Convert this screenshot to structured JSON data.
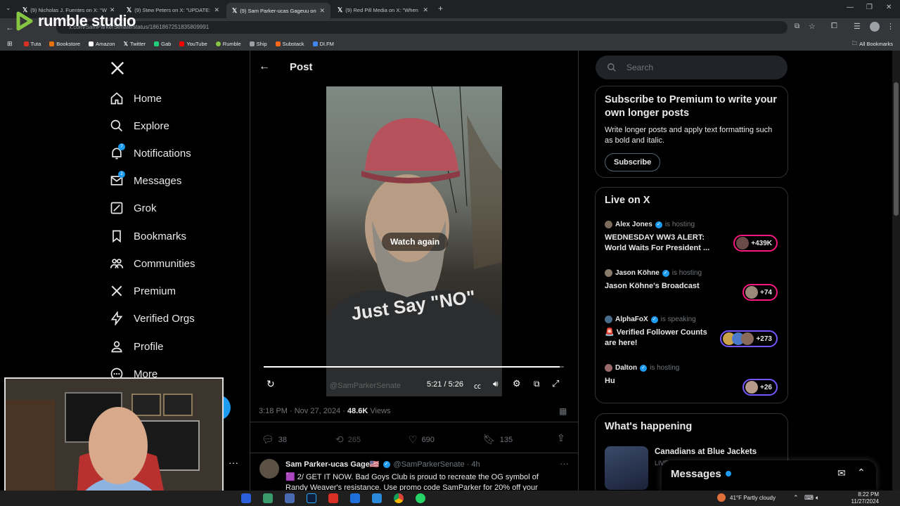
{
  "browser": {
    "tabs": [
      {
        "title": "(9) Nicholas J. Fuentes on X: \"W"
      },
      {
        "title": "(9) Stew Peters on X: \"UPDATE:"
      },
      {
        "title": "(9) Sam Parker-ucas Gageuu on"
      },
      {
        "title": "(9) Red Pill Media on X: \"When"
      }
    ],
    "url": "x.com/SamParkerSenate/status/1861867251835809991",
    "bookmarks": [
      "Tuta",
      "Bookstore",
      "Amazon",
      "Twitter",
      "Gab",
      "YouTube",
      "Rumble",
      "Ship",
      "Substack",
      "DI.FM"
    ],
    "all_bookmarks": "All Bookmarks"
  },
  "watermark": "rumble studio",
  "nav": {
    "items": [
      "Home",
      "Explore",
      "Notifications",
      "Messages",
      "Grok",
      "Bookmarks",
      "Communities",
      "Premium",
      "Verified Orgs",
      "Profile",
      "More"
    ],
    "notifications_badge": "7",
    "messages_badge": "2"
  },
  "header": {
    "title": "Post"
  },
  "video": {
    "overlay_label": "Watch again",
    "time": "5:21 / 5:26",
    "handle_watermark": "@SamParkerSenate",
    "shirt_text": "Just Say \"NO\"",
    "progress": 0.985
  },
  "post_meta": {
    "time": "3:18 PM · Nov 27, 2024 · ",
    "views_count": "48.6K",
    "views_label": " Views"
  },
  "actions": {
    "replies": "38",
    "reposts": "265",
    "likes": "690",
    "bookmarks": "135"
  },
  "reply": {
    "name": "Sam Parker-ucas Gage🇺🇸",
    "handle": "@SamParkerSenate · 4h",
    "text": "🟪 2/ GET IT NOW. Bad Goys Club is proud to recreate the OG symbol of Randy Weaver's resistance. Use promo code SamParker for 20% off your"
  },
  "search": {
    "placeholder": "Search"
  },
  "premium": {
    "title": "Subscribe to Premium to write your own longer posts",
    "body": "Write longer posts and apply text formatting such as bold and italic.",
    "button": "Subscribe"
  },
  "live": {
    "title": "Live on X",
    "rows": [
      {
        "host": "Alex Jones",
        "status": "is hosting",
        "title": "WEDNESDAY WW3 ALERT: World Waits For President ...",
        "count": "+439K"
      },
      {
        "host": "Jason Köhne",
        "status": "is hosting",
        "title": "Jason Köhne's Broadcast",
        "count": "+74"
      },
      {
        "host": "AlphaFoX",
        "status": "is speaking",
        "title": "🚨 Verified Follower Counts are here!",
        "count": "+273"
      },
      {
        "host": "Dalton",
        "status": "is hosting",
        "title": "Hu",
        "count": "+26"
      }
    ]
  },
  "happening": {
    "title": "What's happening",
    "item": "Canadians at Blue Jackets",
    "item_sub": "LIVE"
  },
  "messages_drawer": {
    "title": "Messages"
  },
  "taskbar": {
    "weather": "41°F  Partly cloudy",
    "time": "8:22 PM",
    "date": "11/27/2024"
  },
  "colors": {
    "accent": "#1d9bf0",
    "live_pink": "#f91880",
    "live_purple": "#7856ff"
  }
}
